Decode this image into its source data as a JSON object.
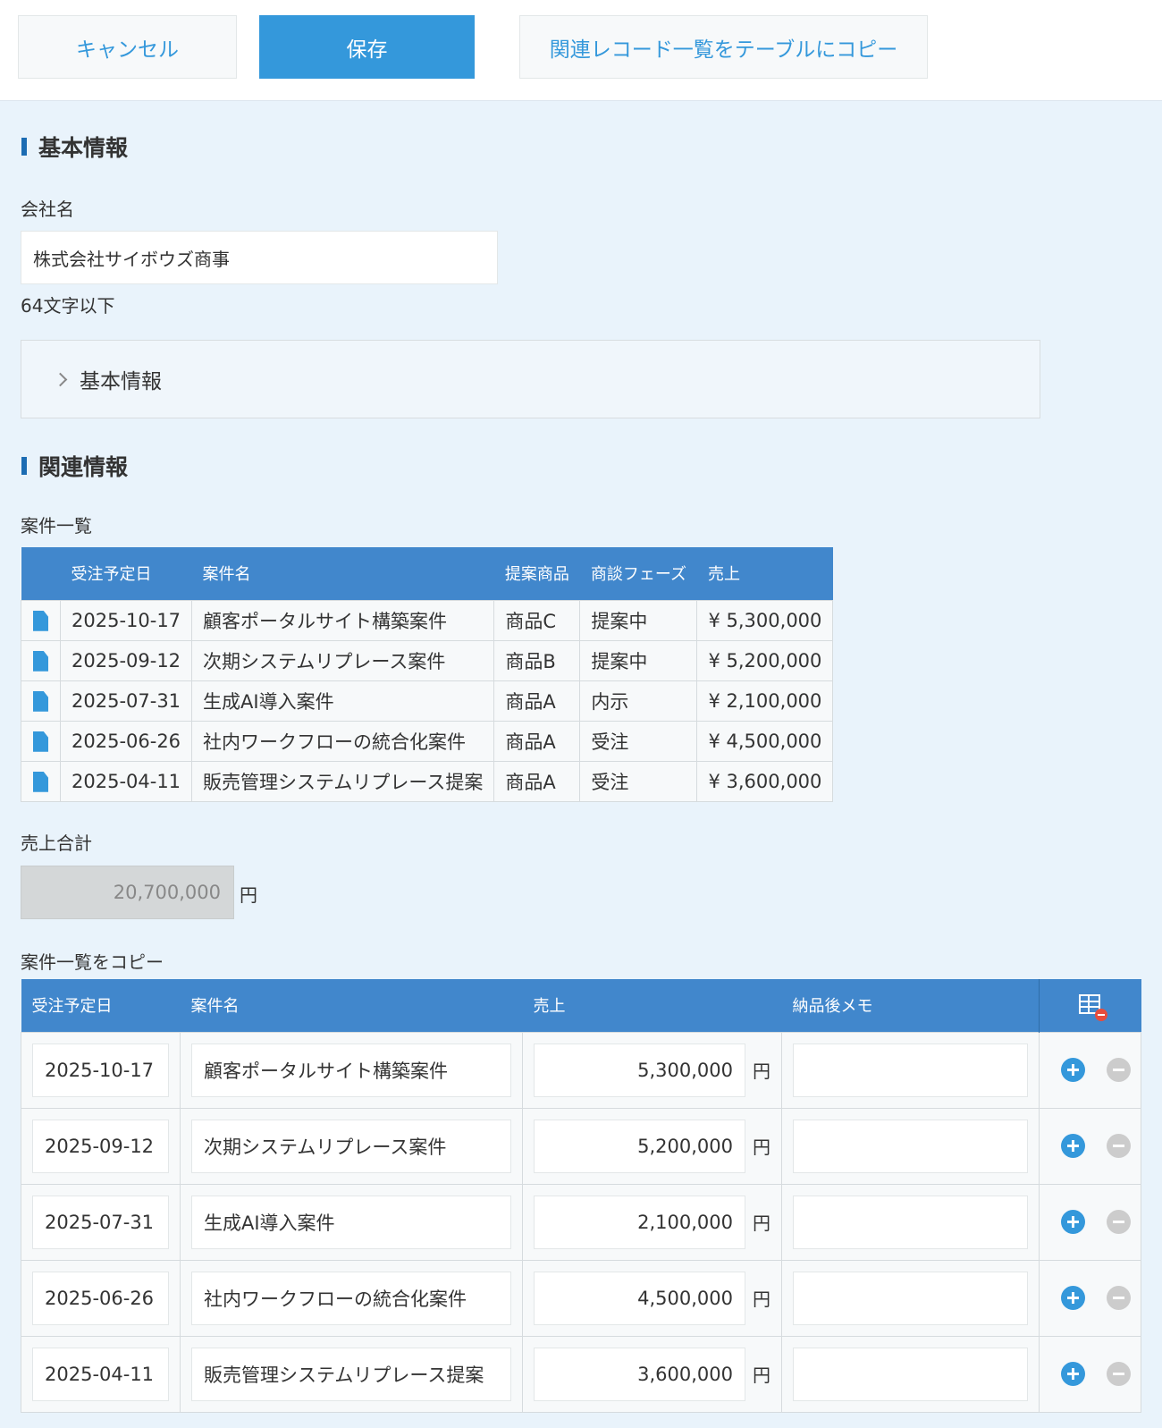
{
  "toolbar": {
    "cancel_label": "キャンセル",
    "save_label": "保存",
    "copy_label": "関連レコード一覧をテーブルにコピー"
  },
  "basic_section": {
    "title": "基本情報",
    "company_label": "会社名",
    "company_value": "株式会社サイボウズ商事",
    "company_hint": "64文字以下",
    "group_label": "基本情報"
  },
  "related_section": {
    "title": "関連情報",
    "list_label": "案件一覧",
    "columns": [
      "受注予定日",
      "案件名",
      "提案商品",
      "商談フェーズ",
      "売上"
    ],
    "rows": [
      {
        "date": "2025-10-17",
        "name": "顧客ポータルサイト構築案件",
        "product": "商品C",
        "phase": "提案中",
        "sales": "¥ 5,300,000"
      },
      {
        "date": "2025-09-12",
        "name": "次期システムリプレース案件",
        "product": "商品B",
        "phase": "提案中",
        "sales": "¥ 5,200,000"
      },
      {
        "date": "2025-07-31",
        "name": "生成AI導入案件",
        "product": "商品A",
        "phase": "内示",
        "sales": "¥ 2,100,000"
      },
      {
        "date": "2025-06-26",
        "name": "社内ワークフローの統合化案件",
        "product": "商品A",
        "phase": "受注",
        "sales": "¥ 4,500,000"
      },
      {
        "date": "2025-04-11",
        "name": "販売管理システムリプレース提案",
        "product": "商品A",
        "phase": "受注",
        "sales": "¥ 3,600,000"
      }
    ]
  },
  "total": {
    "label": "売上合計",
    "value": "20,700,000",
    "unit": "円"
  },
  "copy_table": {
    "label": "案件一覧をコピー",
    "columns": [
      "受注予定日",
      "案件名",
      "売上",
      "納品後メモ"
    ],
    "unit": "円",
    "rows": [
      {
        "date": "2025-10-17",
        "name": "顧客ポータルサイト構築案件",
        "sales": "5,300,000",
        "memo": ""
      },
      {
        "date": "2025-09-12",
        "name": "次期システムリプレース案件",
        "sales": "5,200,000",
        "memo": ""
      },
      {
        "date": "2025-07-31",
        "name": "生成AI導入案件",
        "sales": "2,100,000",
        "memo": ""
      },
      {
        "date": "2025-06-26",
        "name": "社内ワークフローの統合化案件",
        "sales": "4,500,000",
        "memo": ""
      },
      {
        "date": "2025-04-11",
        "name": "販売管理システムリプレース提案",
        "sales": "3,600,000",
        "memo": ""
      }
    ]
  },
  "colors": {
    "accent": "#3498db",
    "header_blue": "#4187cc",
    "page_bg": "#e9f3fb",
    "heading_bar": "#1c6cb3",
    "remove_badge": "#e74c3c"
  },
  "icons": {
    "record_link": "document-icon",
    "group_toggle": "chevron-right-icon",
    "remove_table": "table-remove-icon",
    "add_row": "plus-circle-icon",
    "remove_row": "minus-circle-icon"
  }
}
